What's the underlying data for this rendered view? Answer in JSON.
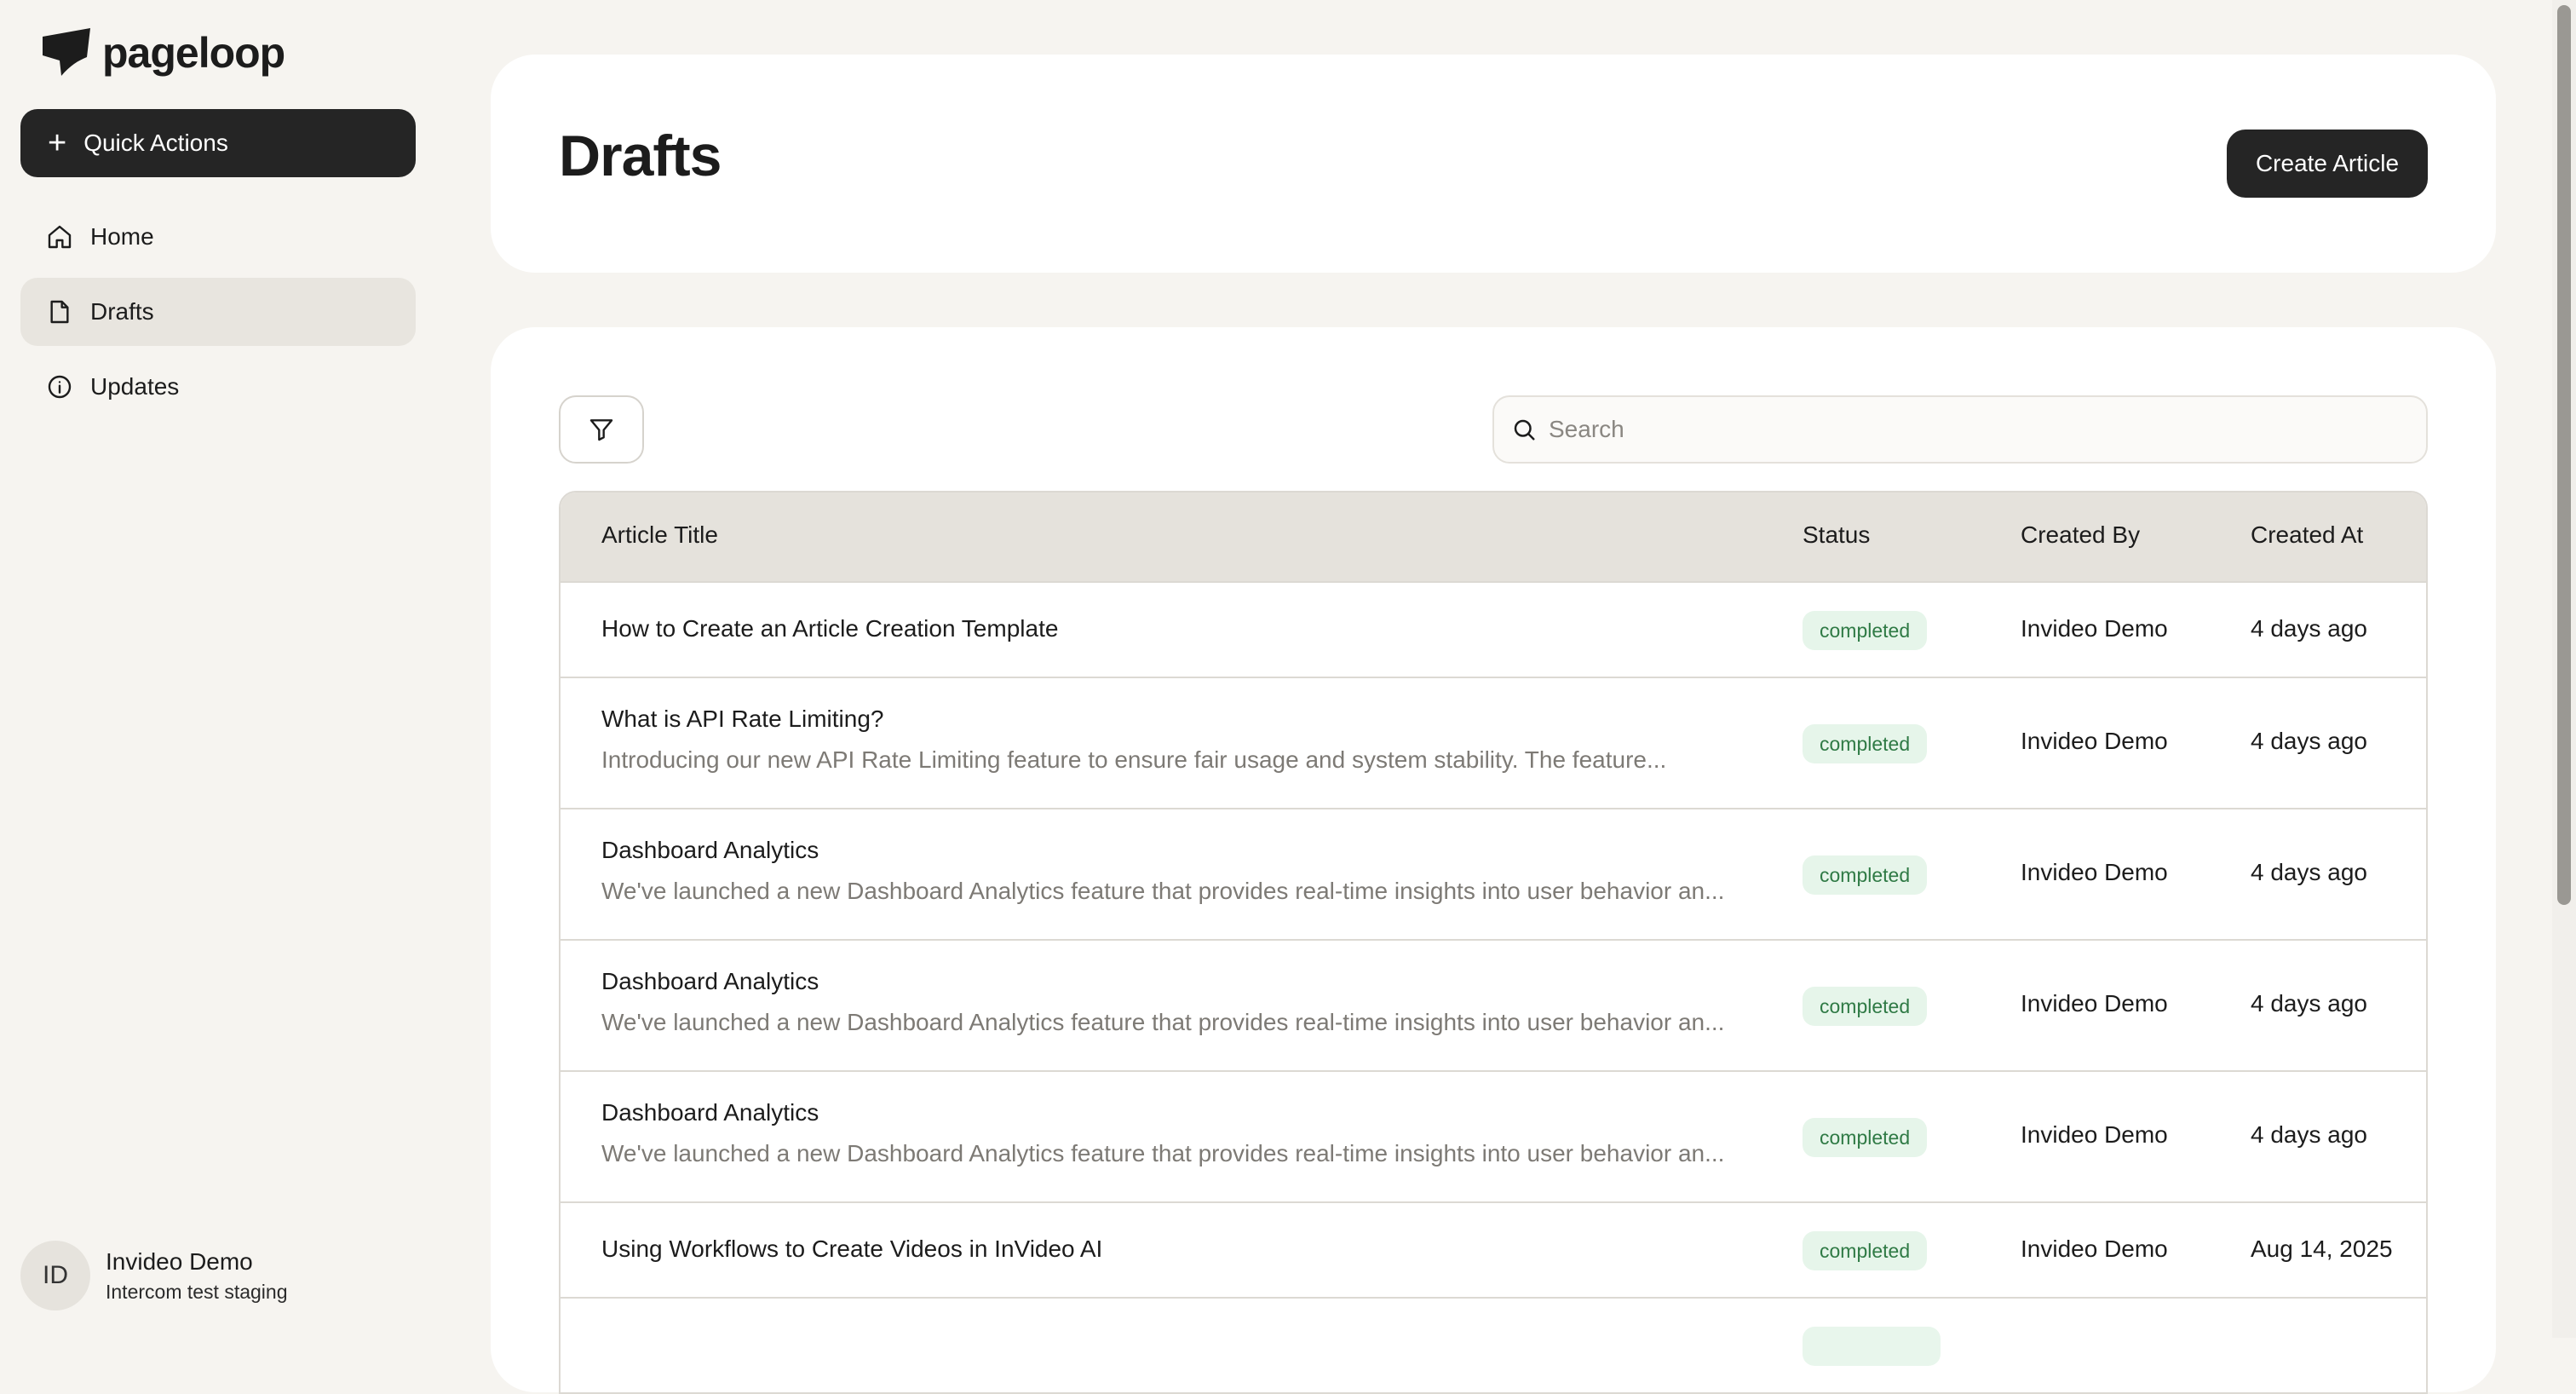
{
  "app": {
    "name": "pageloop"
  },
  "sidebar": {
    "quick_actions_label": "Quick Actions",
    "items": [
      {
        "label": "Home",
        "icon": "home-icon",
        "active": false
      },
      {
        "label": "Drafts",
        "icon": "file-icon",
        "active": true
      },
      {
        "label": "Updates",
        "icon": "info-icon",
        "active": false
      }
    ],
    "user": {
      "initials": "ID",
      "name": "Invideo Demo",
      "org": "Intercom test staging"
    }
  },
  "header": {
    "title": "Drafts",
    "create_label": "Create Article"
  },
  "toolbar": {
    "filter_icon": "filter-icon",
    "search_placeholder": "Search"
  },
  "table": {
    "columns": [
      "Article Title",
      "Status",
      "Created By",
      "Created At"
    ],
    "rows": [
      {
        "title": "How to Create an Article Creation Template",
        "excerpt": "",
        "status": "completed",
        "created_by": "Invideo Demo",
        "created_at": "4 days ago"
      },
      {
        "title": "What is API Rate Limiting?",
        "excerpt": "Introducing our new API Rate Limiting feature to ensure fair usage and system stability. The feature...",
        "status": "completed",
        "created_by": "Invideo Demo",
        "created_at": "4 days ago"
      },
      {
        "title": "Dashboard Analytics",
        "excerpt": "We've launched a new Dashboard Analytics feature that provides real-time insights into user behavior an...",
        "status": "completed",
        "created_by": "Invideo Demo",
        "created_at": "4 days ago"
      },
      {
        "title": "Dashboard Analytics",
        "excerpt": "We've launched a new Dashboard Analytics feature that provides real-time insights into user behavior an...",
        "status": "completed",
        "created_by": "Invideo Demo",
        "created_at": "4 days ago"
      },
      {
        "title": "Dashboard Analytics",
        "excerpt": "We've launched a new Dashboard Analytics feature that provides real-time insights into user behavior an...",
        "status": "completed",
        "created_by": "Invideo Demo",
        "created_at": "4 days ago"
      },
      {
        "title": "Using Workflows to Create Videos in InVideo AI",
        "excerpt": "",
        "status": "completed",
        "created_by": "Invideo Demo",
        "created_at": "Aug 14, 2025"
      }
    ]
  },
  "colors": {
    "accent": "#252525",
    "background": "#f6f4f0",
    "badge_bg": "#e6f5ea",
    "badge_text": "#2f7a45"
  }
}
